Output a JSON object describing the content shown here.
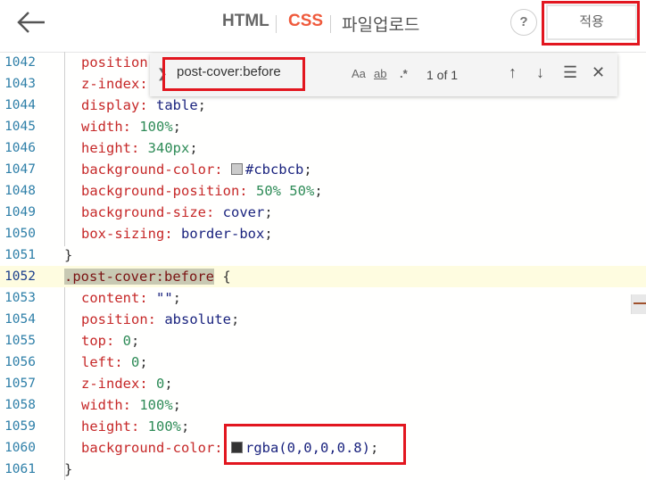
{
  "header": {
    "tabs": [
      {
        "label": "HTML",
        "active": false
      },
      {
        "label": "CSS",
        "active": true
      },
      {
        "label": "파일업로드",
        "active": false
      }
    ],
    "help_label": "?",
    "apply_label": "적용"
  },
  "find": {
    "query": "post-cover:before",
    "opt_case": "Aa",
    "opt_word": "ab",
    "opt_regex": ".*",
    "count": "1 of 1"
  },
  "editor": {
    "lines": [
      {
        "num": "1042",
        "prop": "position",
        "sep": "",
        "val": ""
      },
      {
        "num": "1043",
        "prop": "z-index:",
        "sep": "",
        "val": ""
      },
      {
        "num": "1044",
        "prop": "display:",
        "sep": " ",
        "val": "table"
      },
      {
        "num": "1045",
        "prop": "width:",
        "sep": " ",
        "val": "100%"
      },
      {
        "num": "1046",
        "prop": "height:",
        "sep": " ",
        "val": "340px"
      },
      {
        "num": "1047",
        "prop": "background-color:",
        "sep": " ",
        "val": "#cbcbcb"
      },
      {
        "num": "1048",
        "prop": "background-position:",
        "sep": " ",
        "val": "50% 50%"
      },
      {
        "num": "1049",
        "prop": "background-size:",
        "sep": " ",
        "val": "cover"
      },
      {
        "num": "1050",
        "prop": "box-sizing:",
        "sep": " ",
        "val": "border-box"
      },
      {
        "num": "1051",
        "text": "}"
      },
      {
        "num": "1052",
        "selector": ".post-cover:before",
        "text": " {"
      },
      {
        "num": "1053",
        "prop": "content:",
        "sep": " ",
        "val": "\"\""
      },
      {
        "num": "1054",
        "prop": "position:",
        "sep": " ",
        "val": "absolute"
      },
      {
        "num": "1055",
        "prop": "top:",
        "sep": " ",
        "val": "0"
      },
      {
        "num": "1056",
        "prop": "left:",
        "sep": " ",
        "val": "0"
      },
      {
        "num": "1057",
        "prop": "z-index:",
        "sep": " ",
        "val": "0"
      },
      {
        "num": "1058",
        "prop": "width:",
        "sep": " ",
        "val": "100%"
      },
      {
        "num": "1059",
        "prop": "height:",
        "sep": " ",
        "val": "100%"
      },
      {
        "num": "1060",
        "prop": "background-color:",
        "sep": " ",
        "val": "rgba(0,0,0,0.8)"
      },
      {
        "num": "1061",
        "text": "}"
      }
    ]
  },
  "colors": {
    "accent": "#ef5a3c",
    "highlight_border": "#e2161f",
    "swatch_gray": "#cbcbcb",
    "swatch_dark": "#333333"
  }
}
